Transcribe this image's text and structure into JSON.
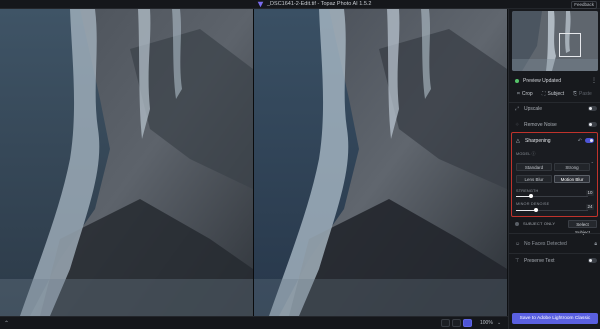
{
  "window": {
    "title": "_DSC1641-2-Edit.tif - Topaz Photo AI 1.5.2",
    "feedback_label": "Feedback"
  },
  "bottombar": {
    "zoom_level": "100%"
  },
  "panel": {
    "preview_status": "Preview Updated",
    "tools": [
      {
        "label": "Crop"
      },
      {
        "label": "Subject"
      },
      {
        "label": "Paste"
      }
    ],
    "upscale": {
      "label": "Upscale",
      "enabled": false
    },
    "remove_noise": {
      "label": "Remove Noise",
      "enabled": false
    },
    "sharpening": {
      "label": "Sharpening",
      "enabled": true,
      "model_label": "MODEL",
      "models": [
        "Standard",
        "Strong",
        "Lens Blur",
        "Motion Blur"
      ],
      "selected_model": "Motion Blur",
      "strength_label": "STRENGTH",
      "strength_value": "10",
      "minor_denoise_label": "MINOR DENOISE",
      "minor_denoise_value": "24"
    },
    "subject": {
      "label": "SUBJECT ONLY",
      "select_label": "Select Subject"
    },
    "faces": {
      "label": "No Faces Detected"
    },
    "preserve_text": {
      "label": "Preserve Text",
      "enabled": false
    },
    "export_label": "Save to Adobe Lightroom Classic"
  },
  "colors": {
    "accent": "#5a60e0",
    "highlight_border": "#c0332c",
    "status_green": "#56c46a"
  }
}
